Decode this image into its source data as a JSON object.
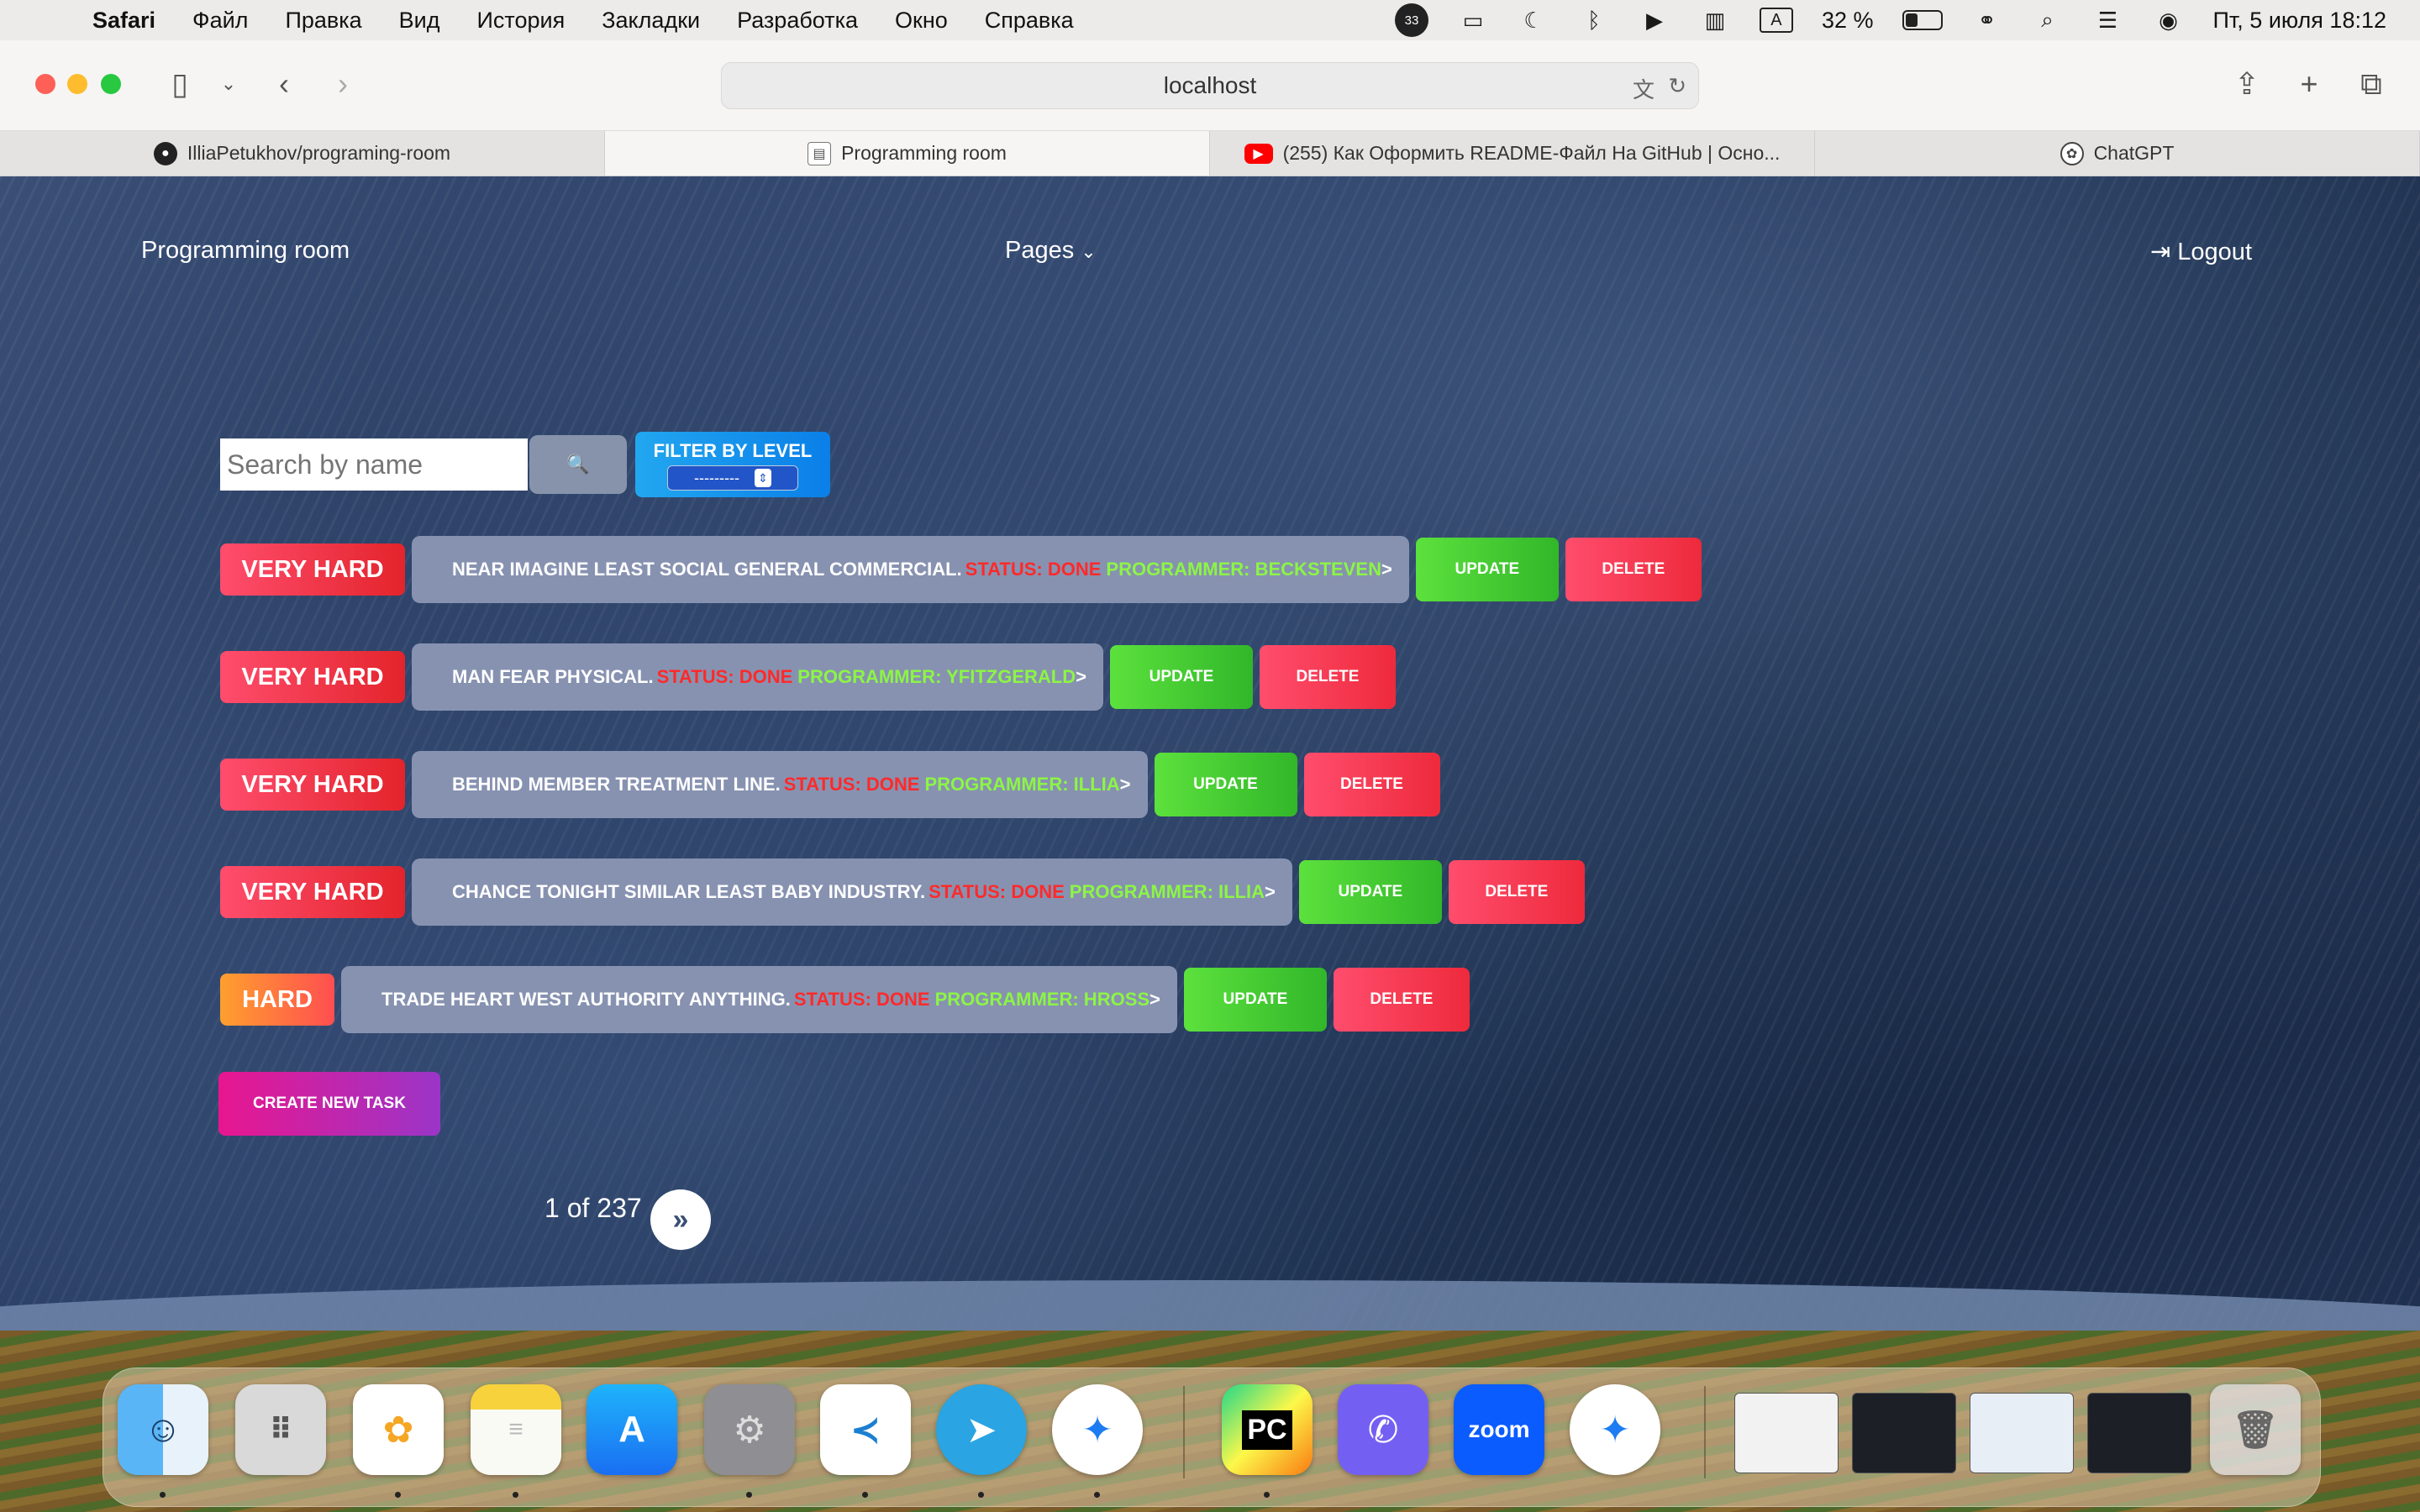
{
  "menubar": {
    "app": "Safari",
    "items": [
      "Файл",
      "Правка",
      "Вид",
      "История",
      "Закладки",
      "Разработка",
      "Окно",
      "Справка"
    ],
    "notif_count": "33",
    "keyboard_layout": "A",
    "battery_percent": "32 %",
    "battery_level": 0.32,
    "datetime": "Пт, 5 июля  18:12"
  },
  "browser": {
    "url": "localhost",
    "tabs": [
      {
        "label": "IlliaPetukhov/programing-room",
        "icon": "github-icon"
      },
      {
        "label": "Programming room",
        "icon": "site-icon"
      },
      {
        "label": "(255) Как Оформить README-Файл На GitHub | Осно...",
        "icon": "youtube-icon"
      },
      {
        "label": "ChatGPT",
        "icon": "chatgpt-icon"
      }
    ]
  },
  "nav": {
    "brand": "Programming room",
    "pages": "Pages",
    "logout": "Logout"
  },
  "search": {
    "placeholder": "Search by name",
    "button_icon": "🔍"
  },
  "filter": {
    "label": "FILTER BY LEVEL",
    "selected": "---------"
  },
  "tasks": [
    {
      "level": "VERY HARD",
      "title": "NEAR IMAGINE LEAST SOCIAL GENERAL COMMERCIAL.",
      "status": "STATUS: DONE",
      "programmer": "PROGRAMMER: BECKSTEVEN",
      "suffix": ">",
      "update": "UPDATE",
      "delete": "DELETE"
    },
    {
      "level": "VERY HARD",
      "title": "MAN FEAR PHYSICAL.",
      "status": "STATUS: DONE",
      "programmer": "PROGRAMMER: YFITZGERALD",
      "suffix": ">",
      "update": "UPDATE",
      "delete": "DELETE"
    },
    {
      "level": "VERY HARD",
      "title": "BEHIND MEMBER TREATMENT LINE.",
      "status": "STATUS: DONE",
      "programmer": "PROGRAMMER: ILLIA",
      "suffix": ">",
      "update": "UPDATE",
      "delete": "DELETE"
    },
    {
      "level": "VERY HARD",
      "title": "CHANCE TONIGHT SIMILAR LEAST BABY INDUSTRY.",
      "status": "STATUS: DONE",
      "programmer": "PROGRAMMER: ILLIA",
      "suffix": ">",
      "update": "UPDATE",
      "delete": "DELETE"
    },
    {
      "level": "HARD",
      "title": "TRADE HEART WEST AUTHORITY ANYTHING.",
      "status": "STATUS: DONE",
      "programmer": "PROGRAMMER: HROSS",
      "suffix": ">",
      "update": "UPDATE",
      "delete": "DELETE"
    }
  ],
  "create_button": "CREATE NEW TASK",
  "pagination": {
    "text": "1 of 237",
    "next_icon": "»"
  },
  "dock": {
    "apps": [
      "finder-icon",
      "launchpad-icon",
      "photos-icon",
      "notes-icon",
      "app-store-icon",
      "system-settings-icon",
      "vscode-icon",
      "telegram-icon",
      "safari-icon",
      "pycharm-icon",
      "viber-icon",
      "zoom-icon",
      "safari-alt-icon"
    ],
    "zoom_label": "zoom",
    "pycharm_label": "PC"
  }
}
